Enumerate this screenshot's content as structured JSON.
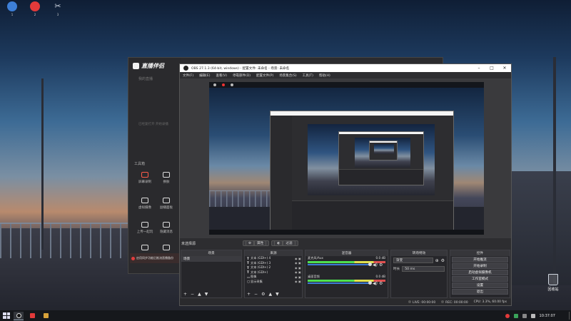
{
  "desktop": {
    "icons": [
      {
        "label": "1",
        "icon": "magnifier-app-icon",
        "color": "#3d7fd8"
      },
      {
        "label": "2",
        "icon": "red-circle-app-icon",
        "color": "#e23a3a"
      },
      {
        "label": "3",
        "icon": "scissors-app-icon",
        "color": "#cfd6e2"
      }
    ],
    "recycle_bin": "回收站"
  },
  "helper": {
    "app_name": "直播伴侣",
    "nav": "我的直播",
    "hint": "已经复打开 开始录播",
    "tools_title": "工具箱",
    "tools": [
      {
        "label": "屏幕录制",
        "icon": "screen-record-icon",
        "accent": true
      },
      {
        "label": "换肤",
        "icon": "skin-icon"
      },
      {
        "label": "虚拟摄像",
        "icon": "virtual-camera-icon"
      },
      {
        "label": "副播面板",
        "icon": "co-host-icon"
      },
      {
        "label": "上传一起玩",
        "icon": "upload-play-icon"
      },
      {
        "label": "隐藏消息",
        "icon": "hide-message-icon"
      },
      {
        "label": "工具",
        "icon": "tool-icon"
      },
      {
        "label": "下载",
        "icon": "download-icon"
      }
    ],
    "notice": "启用同步功能后推流直播备份"
  },
  "obs": {
    "title": "OBS 27.1.3 (64-bit, windows) - 配置文件: 未命名 - 场景: 未命名",
    "window_controls": [
      "–",
      "□",
      "✕"
    ],
    "menu": [
      "文件(F)",
      "编辑(E)",
      "查看(V)",
      "停靠部件(D)",
      "配置文件(P)",
      "场景集合(S)",
      "工具(T)",
      "帮助(H)"
    ],
    "scene_selected_label": "未选择源",
    "toolbar_buttons": [
      {
        "label": "属性",
        "icon": "gear-icon"
      },
      {
        "label": "过滤",
        "icon": "filter-icon"
      }
    ],
    "panes": {
      "scenes": {
        "title": "场景",
        "items": [
          "场景"
        ]
      },
      "sources": {
        "title": "来源",
        "items": [
          {
            "name": "文本 (GDI+) 4"
          },
          {
            "name": "文本 (GDI+) 3"
          },
          {
            "name": "文本 (GDI+) 2"
          },
          {
            "name": "文本 (GDI+)"
          },
          {
            "name": "图像"
          },
          {
            "name": "显示采集"
          }
        ]
      },
      "mixer": {
        "title": "混音器",
        "tracks": [
          {
            "name": "麦克风/Aux",
            "db": "0.0 dB"
          },
          {
            "name": "桌面音频",
            "db": "0.0 dB"
          }
        ]
      },
      "transitions": {
        "title": "转场特效",
        "type": "渐变",
        "duration_label": "时长",
        "duration": "50 ms"
      },
      "controls": {
        "title": "控件",
        "buttons": [
          "开始推流",
          "开始录制",
          "启动虚拟摄像机",
          "工作室模式",
          "设置",
          "退出"
        ]
      }
    },
    "status": {
      "live": "LIVE: 00:00:00",
      "rec": "REC: 00:00:00",
      "cpu": "CPU: 3.3%, 60.00 fps"
    }
  },
  "taskbar": {
    "time": "10:37:07",
    "tray_icons": [
      "network-icon",
      "volume-icon",
      "obs-tray-icon"
    ],
    "apps": [
      {
        "name": "obs-app",
        "color": "#111111"
      },
      {
        "name": "live-helper-app",
        "color": "#e23a3a"
      },
      {
        "name": "file-explorer-app",
        "color": "#d8a23a"
      }
    ]
  }
}
